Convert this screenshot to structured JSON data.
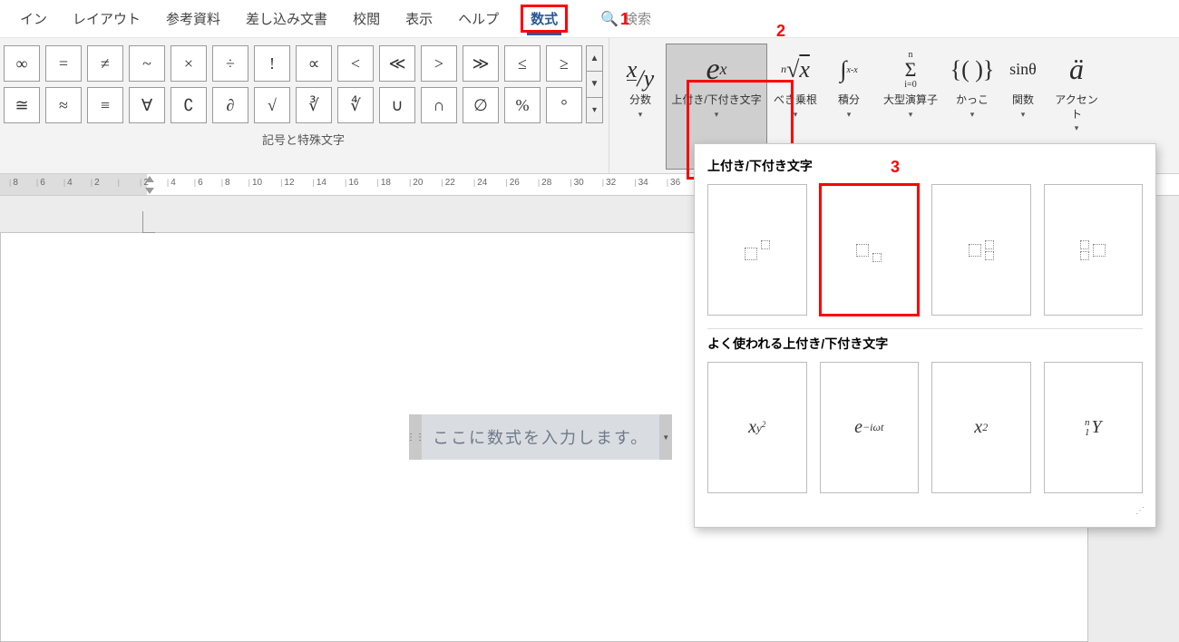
{
  "menu": {
    "items": [
      "イン",
      "レイアウト",
      "参考資料",
      "差し込み文書",
      "校閲",
      "表示",
      "ヘルプ",
      "数式"
    ],
    "active_index": 7,
    "search_label": "検索"
  },
  "annotations": {
    "a1": "1",
    "a2": "2",
    "a3": "3"
  },
  "symbols": {
    "row1": [
      "∞",
      "=",
      "≠",
      "~",
      "×",
      "÷",
      "!",
      "∝",
      "<",
      "≪",
      ">",
      "≫",
      "≤",
      "≥"
    ],
    "row2": [
      "≅",
      "≈",
      "≡",
      "∀",
      "∁",
      "∂",
      "√",
      "∛",
      "∜",
      "∪",
      "∩",
      "∅",
      "%",
      "°"
    ],
    "caption": "記号と特殊文字"
  },
  "ruler": {
    "ticks": [
      "8",
      "6",
      "4",
      "2",
      "",
      "2",
      "4",
      "6",
      "8",
      "10",
      "12",
      "14",
      "16",
      "18",
      "20",
      "22",
      "24",
      "26",
      "28",
      "30",
      "32",
      "34",
      "36"
    ]
  },
  "structures": {
    "items": [
      {
        "icon": "x/y",
        "label": "分数"
      },
      {
        "icon": "eˣ",
        "label": "上付き/下付き文字",
        "selected": true
      },
      {
        "icon": "ⁿ√x",
        "label": "べき乗根"
      },
      {
        "icon": "∫ₓˣ",
        "label": "積分"
      },
      {
        "icon": "Σⁿᵢ₌₀",
        "label": "大型演算子"
      },
      {
        "icon": "{()}",
        "label": "かっこ"
      },
      {
        "icon": "sinθ",
        "label": "関数"
      },
      {
        "icon": "ä",
        "label": "アクセント"
      }
    ]
  },
  "equation_placeholder": "ここに数式を入力します。",
  "gallery": {
    "section1_title": "上付き/下付き文字",
    "section2_title": "よく使われる上付き/下付き文字",
    "common": [
      "x_{y^2}",
      "e^{-iωt}",
      "x^2",
      "ⁿ₁Y"
    ]
  },
  "chart_data": null
}
